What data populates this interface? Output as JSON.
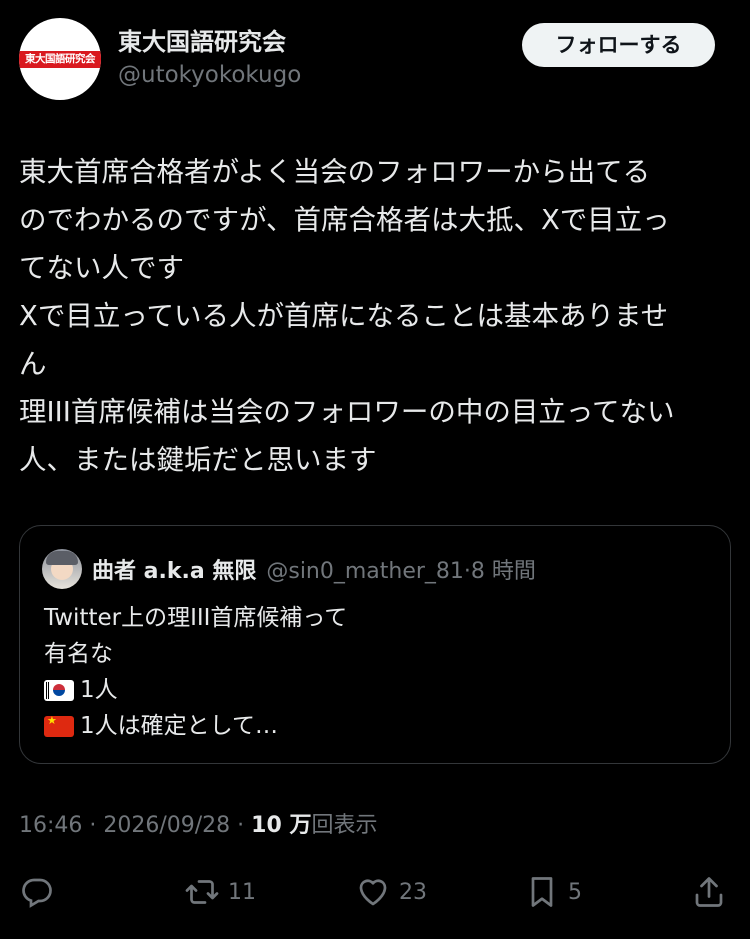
{
  "author": {
    "avatar_text": "東大国語研究会",
    "display_name": "東大国語研究会",
    "handle": "@utokyokokugo",
    "follow_label": "フォローする"
  },
  "tweet": {
    "lines": [
      "東大首席合格者がよく当会のフォロワーから出てる",
      "のでわかるのですが、首席合格者は大抵、Xで目立っ",
      "てない人です",
      "Xで目立っている人が首席になることは基本ありませ",
      "ん",
      "理III首席候補は当会のフォロワーの中の目立ってない",
      "人、または鍵垢だと思います"
    ]
  },
  "quote": {
    "display_name": "曲者 a.k.a 無限",
    "handle_time": "@sin0_mather_81·8 時間",
    "lines": [
      "Twitter上の理III首席候補って",
      "有名な",
      "1人",
      "1人は確定として…"
    ],
    "flags": [
      "south-korea-flag-icon",
      "china-flag-icon"
    ]
  },
  "meta": {
    "time_date": "16:46 · 2026/09/28 · ",
    "views_number": "10 万",
    "views_label": "回表示"
  },
  "actions": {
    "reply_icon": "reply-icon",
    "retweet_count": "11",
    "like_count": "23",
    "bookmark_count": "5",
    "share_icon": "share-icon"
  },
  "colors": {
    "background": "#000000",
    "text": "#e7e9ea",
    "muted": "#71767b",
    "border": "#333639",
    "brand_red": "#d9191f"
  }
}
